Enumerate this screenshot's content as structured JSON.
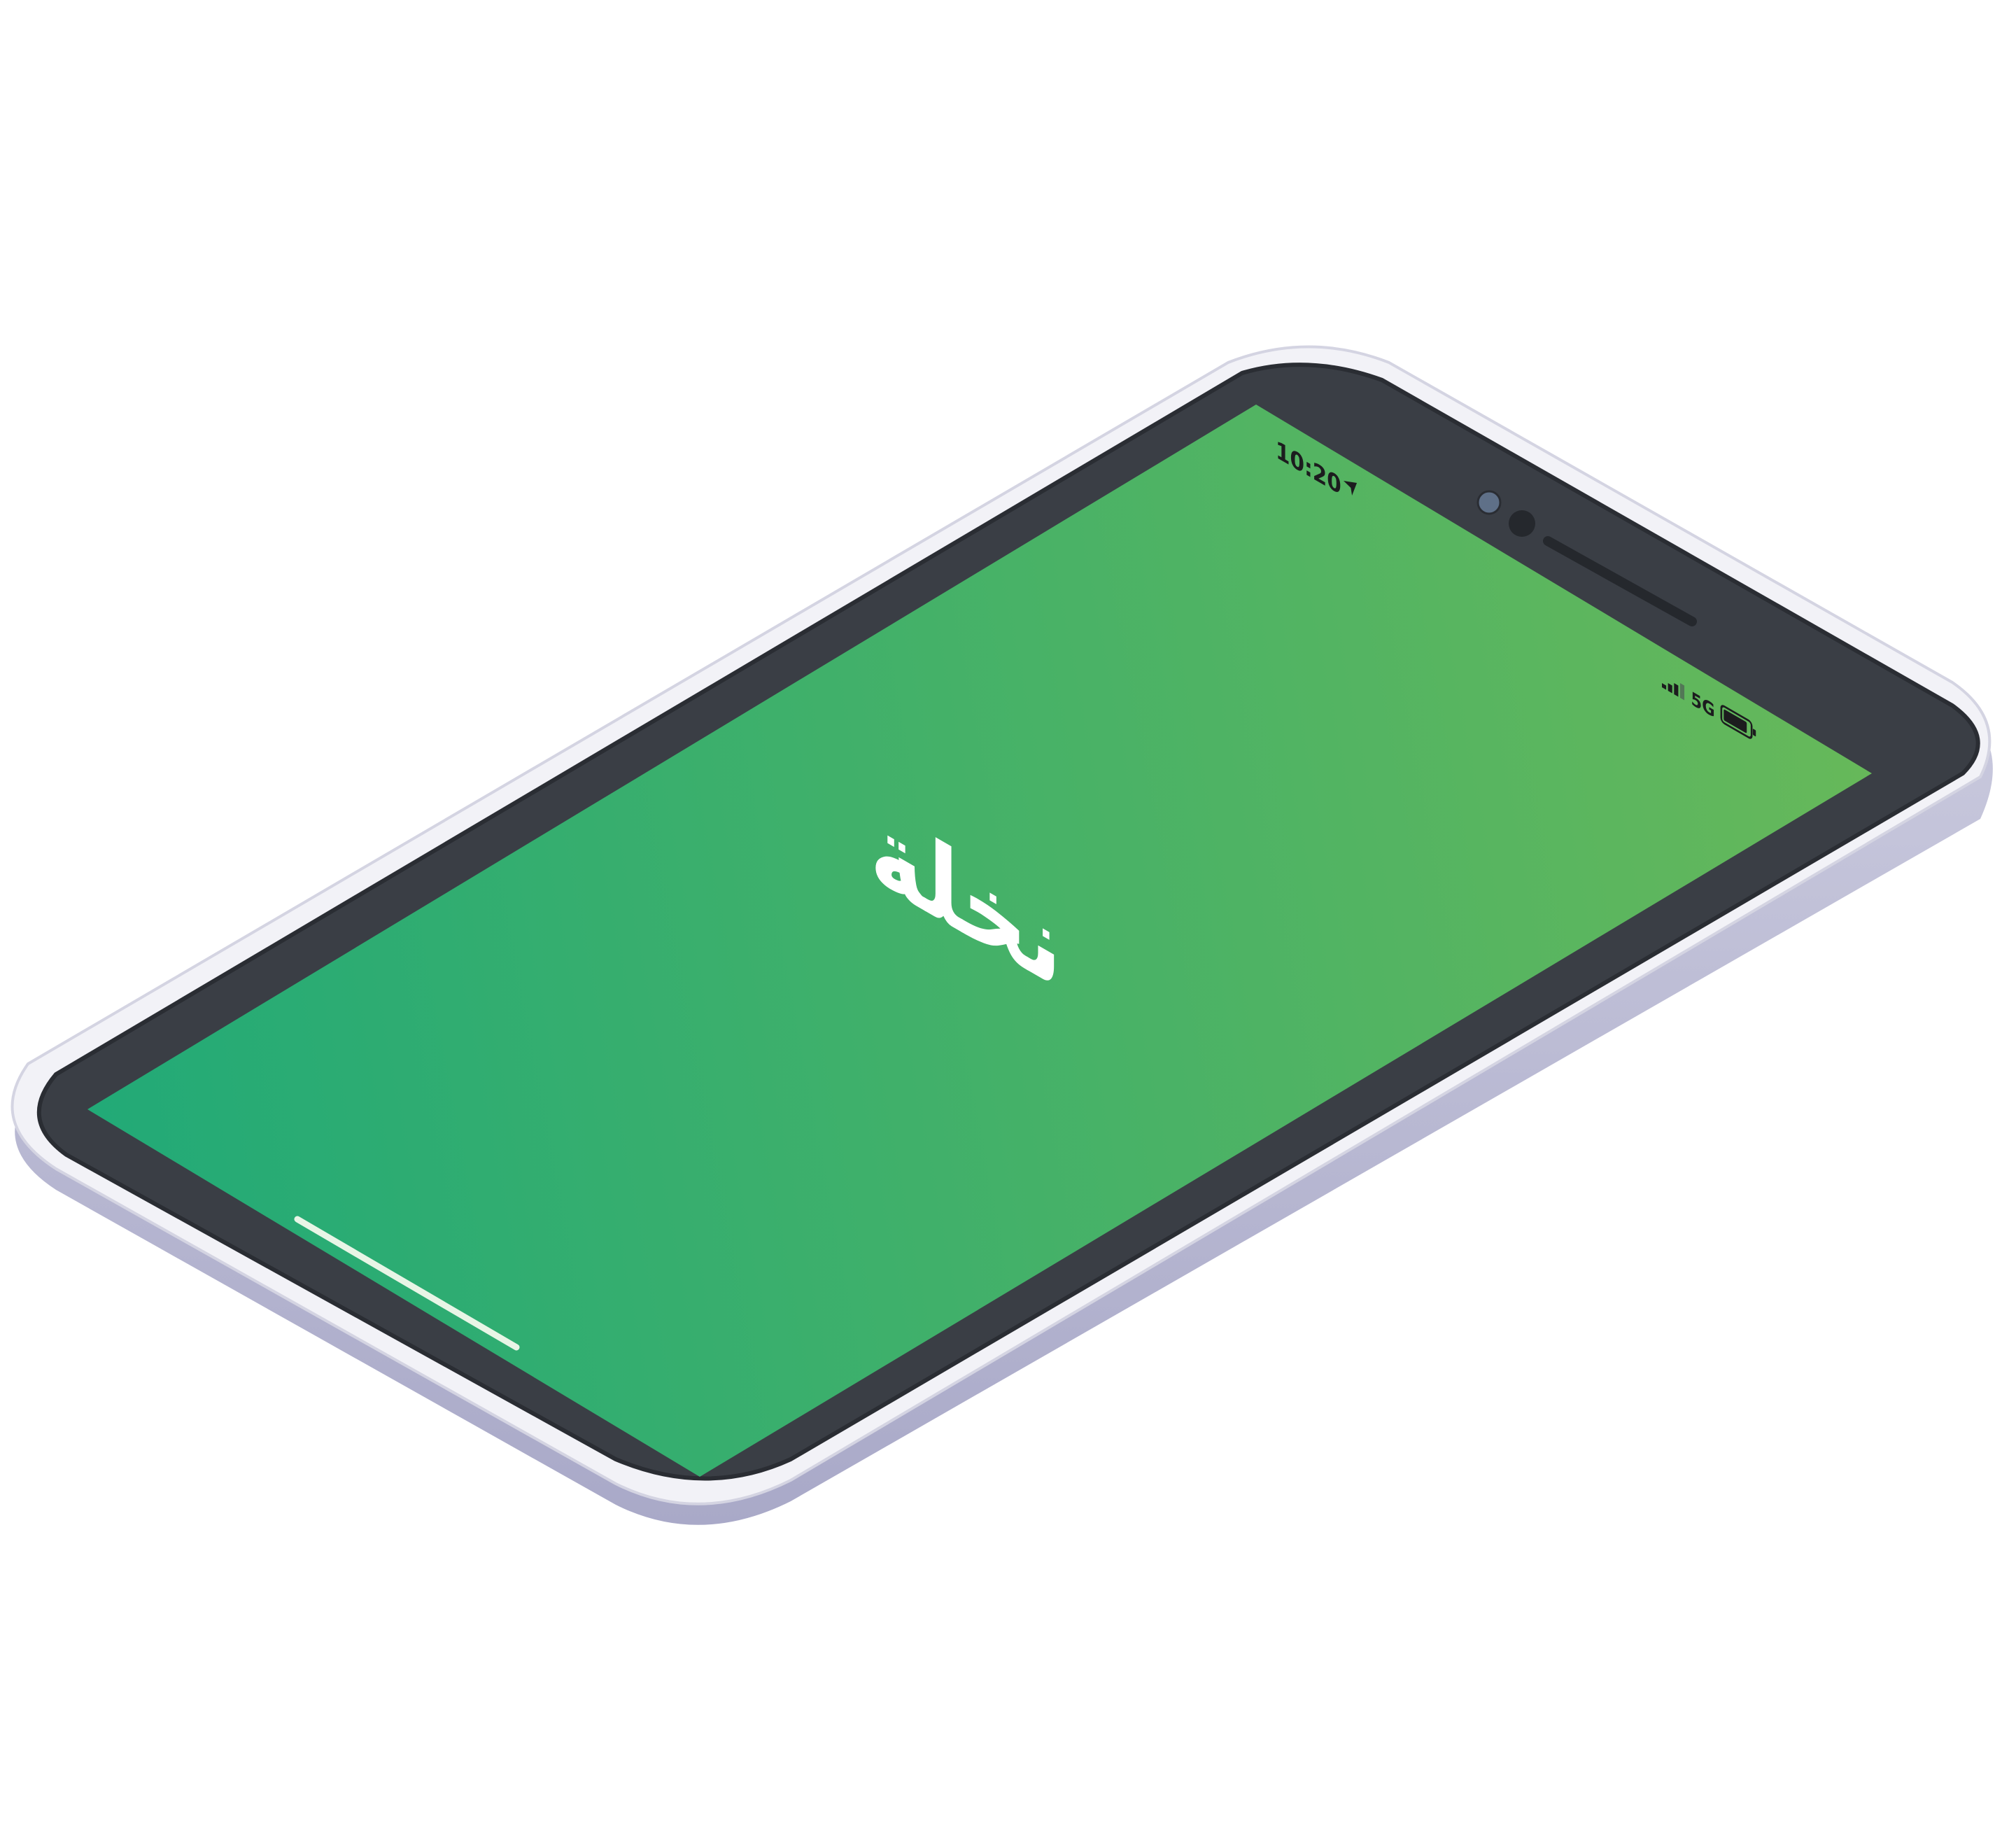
{
  "device": {
    "type": "phone",
    "orientation": "landscape",
    "view": "isometric"
  },
  "status_bar": {
    "time": "10:20",
    "location_icon": "location-arrow-icon",
    "network": "5G",
    "signal_icon": "cellular-signal-icon",
    "battery_icon": "battery-icon"
  },
  "screen": {
    "app_title": "نخلة",
    "gradient_start": "#22aa77",
    "gradient_end": "#66b85a"
  },
  "colors": {
    "bezel": "#3a3e45",
    "frame": "#f2f2f7",
    "frame_edge": "#b9b9d2"
  }
}
